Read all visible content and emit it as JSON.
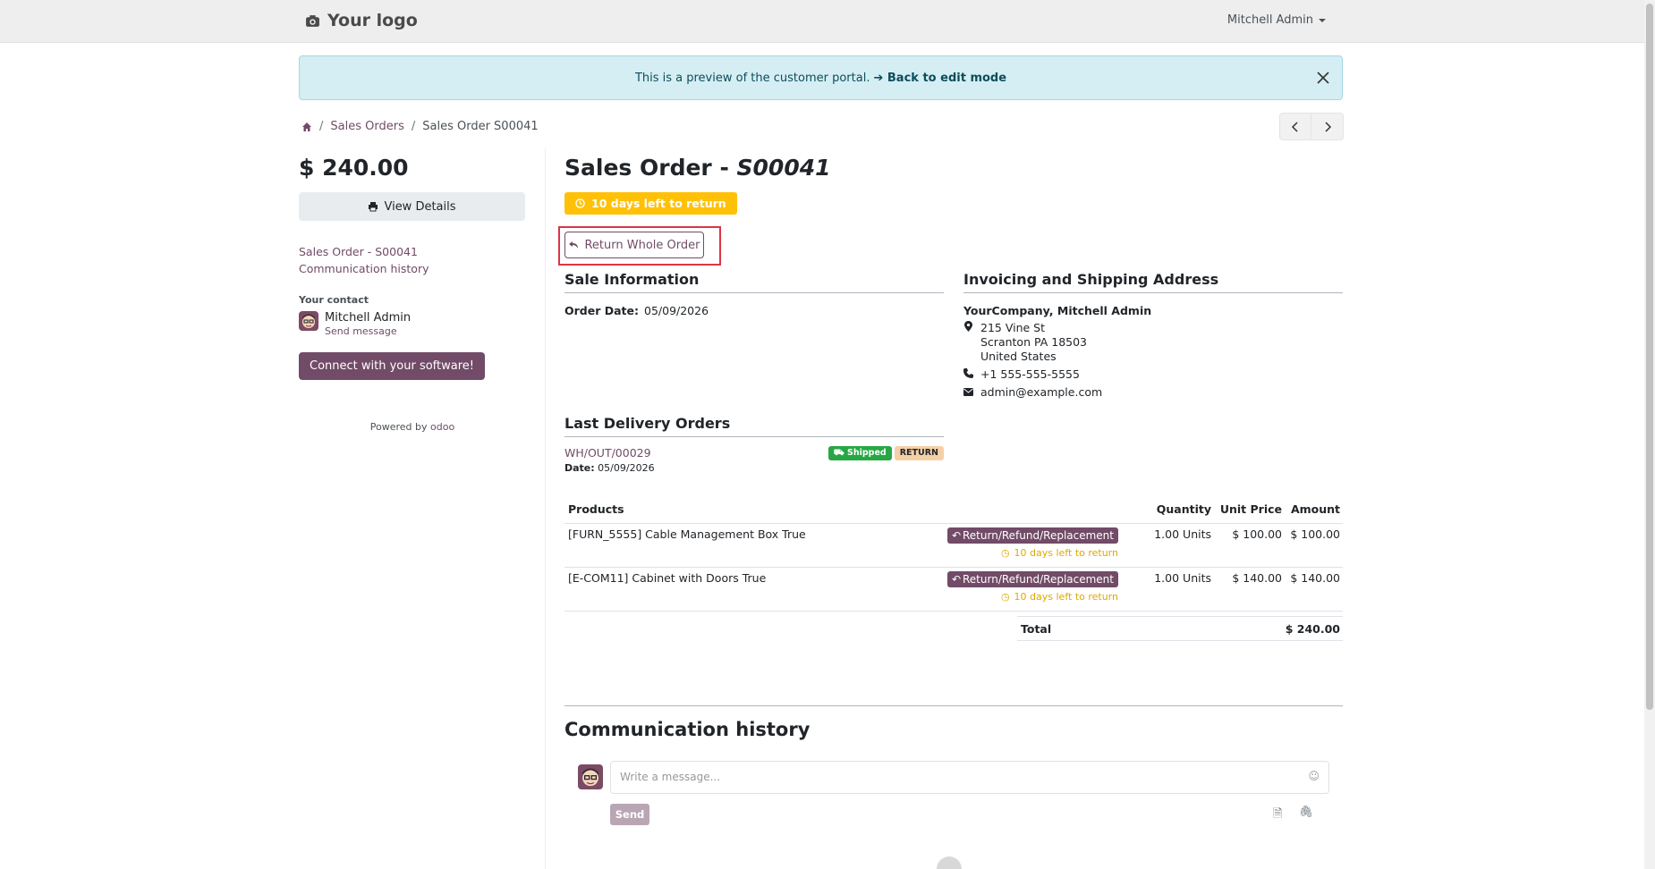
{
  "header": {
    "logo_text": "Your logo",
    "user": "Mitchell Admin"
  },
  "alert": {
    "text": "This is a preview of the customer portal.",
    "link": "Back to edit mode"
  },
  "breadcrumb": {
    "item1": "Sales Orders",
    "item2": "Sales Order S00041"
  },
  "sidebar": {
    "amount": "$ 240.00",
    "view_details": "View Details",
    "link1": "Sales Order - S00041",
    "link2": "Communication history",
    "contact_title": "Your contact",
    "contact_name": "Mitchell Admin",
    "send_message": "Send message",
    "connect": "Connect with your software!",
    "powered_by": "Powered by",
    "brand": "odoo"
  },
  "main": {
    "title_prefix": "Sales Order - ",
    "title_ref": "S00041",
    "return_badge": "10 days left to return",
    "return_whole": "Return Whole Order",
    "sale_info_title": "Sale Information",
    "order_date_label": "Order Date:",
    "order_date": "05/09/2026",
    "address_title": "Invoicing and Shipping Address",
    "company": "YourCompany, Mitchell Admin",
    "street": "215 Vine St",
    "city": "Scranton PA 18503",
    "country": "United States",
    "phone": "+1 555-555-5555",
    "email": "admin@example.com",
    "delivery_title": "Last Delivery Orders",
    "delivery_ref": "WH/OUT/00029",
    "shipped": "Shipped",
    "return_tag": "RETURN",
    "delivery_date_label": "Date:",
    "delivery_date": "05/09/2026"
  },
  "table": {
    "headers": {
      "products": "Products",
      "quantity": "Quantity",
      "unit_price": "Unit Price",
      "amount": "Amount"
    },
    "rows": [
      {
        "product": "[FURN_5555] Cable Management Box True",
        "action": "Return/Refund/Replacement",
        "days": "10 days left to return",
        "qty": "1.00 Units",
        "unit": "$ 100.00",
        "amount": "$ 100.00"
      },
      {
        "product": "[E-COM11] Cabinet with Doors True",
        "action": "Return/Refund/Replacement",
        "days": "10 days left to return",
        "qty": "1.00 Units",
        "unit": "$ 140.00",
        "amount": "$ 140.00"
      }
    ],
    "total_label": "Total",
    "total_value": "$ 240.00"
  },
  "communication": {
    "title": "Communication history",
    "placeholder": "Write a message...",
    "send": "Send"
  },
  "colors": {
    "primary": "#714b67",
    "warning": "#ffc107",
    "success": "#28a745",
    "info_bg": "#d5eef3"
  },
  "icons": [
    "camera-icon",
    "close-icon",
    "home-icon",
    "chevron-left-icon",
    "chevron-right-icon",
    "print-icon",
    "clock-icon",
    "undo-icon",
    "map-marker-icon",
    "phone-icon",
    "envelope-icon",
    "truck-icon",
    "emoji-icon",
    "file-icon",
    "paperclip-icon"
  ]
}
